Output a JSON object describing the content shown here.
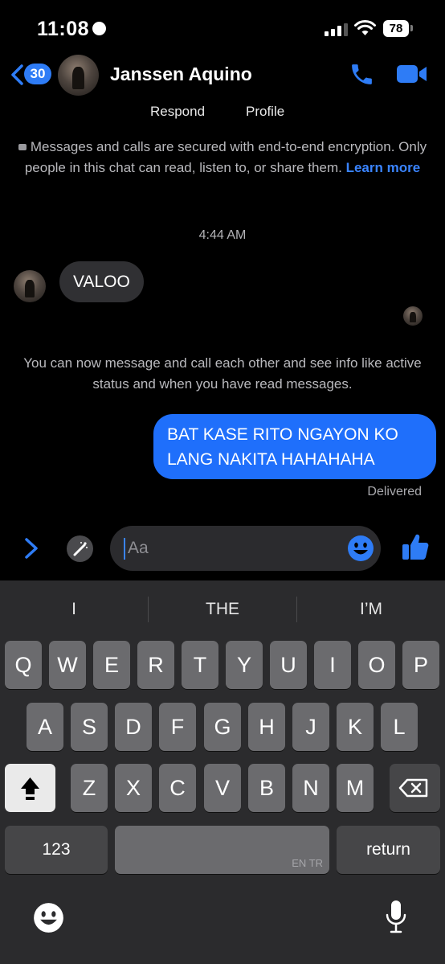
{
  "status_bar": {
    "time": "11:08",
    "battery": "78"
  },
  "header": {
    "back_count": "30",
    "contact_name": "Janssen Aquino",
    "respond_label": "Respond",
    "profile_label": "Profile"
  },
  "chat": {
    "encryption_notice": "Messages and calls are secured with end-to-end encryption. Only people in this chat can read, listen to, or share them.",
    "learn_more": "Learn more",
    "timestamp": "4:44 AM",
    "incoming_message": "VALOO",
    "info_notice": "You can now message and call each other and see info like active status and when you have read messages.",
    "outgoing_message": "BAT KASE RITO NGAYON KO LANG NAKITA HAHAHAHA",
    "delivery_status": "Delivered"
  },
  "composer": {
    "placeholder": "Aa"
  },
  "keyboard": {
    "suggestions": [
      "I",
      "THE",
      "I’M"
    ],
    "row1": [
      "Q",
      "W",
      "E",
      "R",
      "T",
      "Y",
      "U",
      "I",
      "O",
      "P"
    ],
    "row2": [
      "A",
      "S",
      "D",
      "F",
      "G",
      "H",
      "J",
      "K",
      "L"
    ],
    "row3": [
      "Z",
      "X",
      "C",
      "V",
      "B",
      "N",
      "M"
    ],
    "numbers_label": "123",
    "space_lang": "EN TR",
    "return_label": "return"
  },
  "colors": {
    "accent": "#2e7cf6",
    "outgoing_bubble": "#1f6ffb",
    "incoming_bubble": "#303033"
  }
}
